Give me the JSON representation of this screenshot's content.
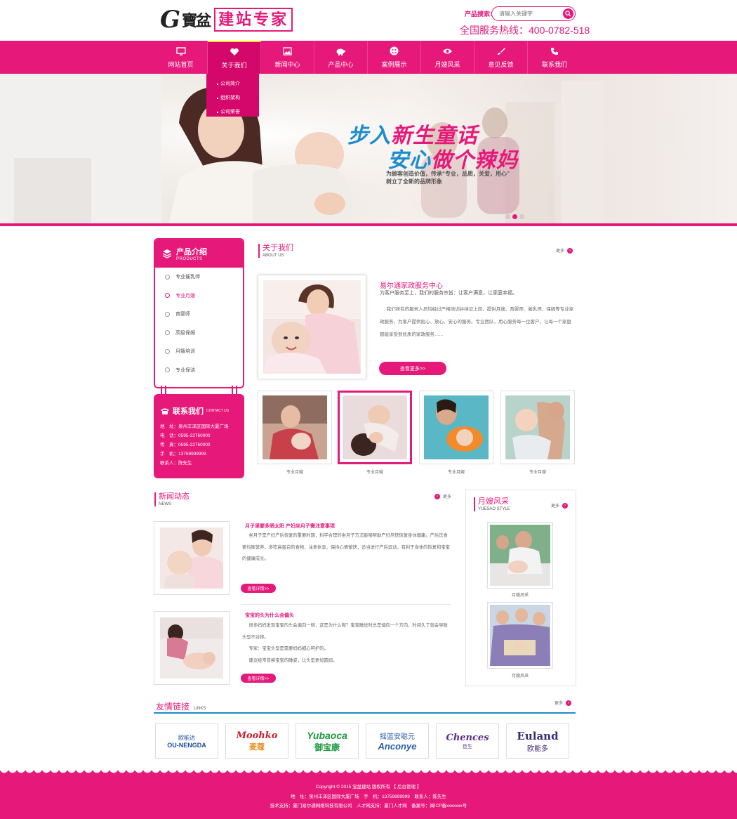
{
  "header": {
    "logo_mark": "寶盆",
    "logo_text": "建站专家",
    "search_label": "产品搜索：",
    "search_placeholder": "请输入关键字",
    "hotline": "全国服务热线：400-0782-518"
  },
  "nav": {
    "items": [
      {
        "label": "网站首页",
        "icon": "monitor-icon"
      },
      {
        "label": "关于我们",
        "icon": "heart-icon"
      },
      {
        "label": "新闻中心",
        "icon": "picture-icon"
      },
      {
        "label": "产品中心",
        "icon": "piggy-bank-icon"
      },
      {
        "label": "案例展示",
        "icon": "smile-icon"
      },
      {
        "label": "月嫂风采",
        "icon": "eye-icon"
      },
      {
        "label": "意见反馈",
        "icon": "brush-icon"
      },
      {
        "label": "联系我们",
        "icon": "phone-icon"
      }
    ],
    "dropdown": [
      "公司简介",
      "组织架构",
      "公司荣誉"
    ]
  },
  "banner": {
    "title1_a": "步入",
    "title1_b": "新生童话",
    "title2_a": "安心",
    "title2_b": "做个辣妈",
    "sub1": "为顾客创造价值，传承“专业，品质，关爱，用心”",
    "sub2": "树立了全新的品牌形象"
  },
  "products": {
    "title": "产品介绍",
    "title_en": "PRODUCTS",
    "items": [
      "专业催乳师",
      "专业月嫂",
      "育婴师",
      "高级保姆",
      "月嫂培训",
      "专业保洁"
    ]
  },
  "contact": {
    "title": "联系我们",
    "title_en": "CONTACT US",
    "lines": [
      "地　址：泉州丰泽区国际大厦广场",
      "电　话：0595-22760000",
      "传　真：0595-22760000",
      "手　机：13759999999",
      "联系人：陈先生"
    ]
  },
  "about": {
    "title": "关于我们",
    "title_en": "ABOUT US",
    "more": "更多",
    "heading": "易尔通家政服务中心",
    "lead": "为客户服务至上，我们的服务宗旨：让客户满意，让家庭幸福。",
    "text": "我们所有的服务人员均经过严格培训并持证上岗，提供月嫂、育婴师、催乳师、保姆等专业家政服务，为客户提供贴心、放心、安心的服务。专业团队，用心服务每一位客户，让每一个家庭都能享受到优质的家政服务……",
    "button": "查看更多>>"
  },
  "gallery": [
    {
      "caption": "专业月嫂"
    },
    {
      "caption": "专业月嫂"
    },
    {
      "caption": "专业月嫂"
    },
    {
      "caption": "专业月嫂"
    }
  ],
  "news": {
    "title": "新闻动态",
    "title_en": "NEWS",
    "more": "更多",
    "items": [
      {
        "title": "月子里要多晒太阳 产妇坐月子需注意事项",
        "body": "坐月子是产妇产后恢复的重要时期，科学合理的坐月子方法能够帮助产妇尽快恢复身体健康。产后饮食要均衡营养，多吃高蛋白的食物，注意休息，保持心情愉快，适当进行产后运动，有利于身体的恢复和宝宝的健康成长。",
        "button": "查看详情>>"
      },
      {
        "title": "宝宝的头为什么会偏头",
        "body": "很多妈妈发现宝宝的头会偏向一侧，这是为什么呢？宝宝睡觉时总是偏向一个方向，时间久了就会导致头型不对称。",
        "body2": "专家：宝宝头型是需要妈妈细心呵护的。",
        "body3": "建议经常变换宝宝的睡姿，让头型更加圆润。",
        "button": "查看详情>>"
      }
    ]
  },
  "yuesao": {
    "title": "月嫂风采",
    "title_en": "YUESAO STYLE",
    "more": "更多",
    "items": [
      {
        "caption": "月嫂风采"
      },
      {
        "caption": "月嫂风采"
      }
    ]
  },
  "links": {
    "title": "友情链接",
    "title_en": "LINKS",
    "more": "更多",
    "items": [
      {
        "name": "OU-NENGDA",
        "cn": "欧能达",
        "color": "#1c4f9c"
      },
      {
        "name": "Moohko",
        "cn": "麦蔻",
        "color": "#c9202c"
      },
      {
        "name": "Yubaoca",
        "cn": "御宝康",
        "color": "#1a9a3c"
      },
      {
        "name": "Anconye",
        "cn": "摇篮安聪元",
        "color": "#2b5ea8"
      },
      {
        "name": "Chences",
        "cn": "臣生",
        "color": "#5b2d8c"
      },
      {
        "name": "Euland",
        "cn": "欧能多",
        "color": "#3a2a78"
      }
    ]
  },
  "footer": {
    "line1": "Copyright © 2015 宝盆建站 版权所有 【 后台管理 】",
    "line2": "地　址：泉州丰泽区国际大厦广场　手　机：13759999999　联系人：陈先生",
    "line3": "技术支持：厦门易尔通网络科技有限公司　人才网支持：厦门人才网　备案号：闽ICP备xxxxxxx号"
  },
  "colors": {
    "accent": "#e6197a",
    "blue": "#1d8ccd"
  }
}
